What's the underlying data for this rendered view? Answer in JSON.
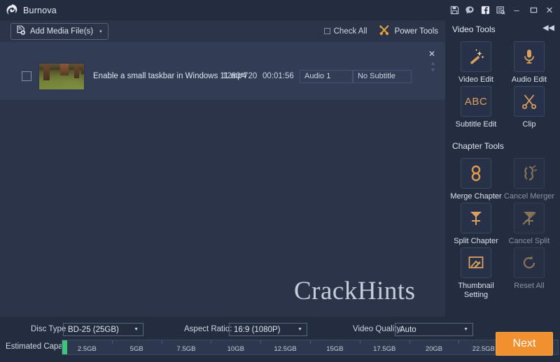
{
  "window": {
    "app_title": "Burnova",
    "logo_icon": "burnova-swirl-logo",
    "title_icons": [
      {
        "name": "save-icon",
        "glyph": "save"
      },
      {
        "name": "feedback-icon",
        "glyph": "comment"
      },
      {
        "name": "facebook-icon",
        "glyph": "facebook"
      },
      {
        "name": "register-icon",
        "glyph": "note-search"
      }
    ],
    "controls": {
      "minimize": "–",
      "maximize": "☐",
      "close": "✕"
    }
  },
  "toolbar": {
    "add_media_label": "Add Media File(s)",
    "add_media_icon": "add-file-icon",
    "add_media_caret": "▾",
    "check_all_label": "Check All",
    "power_tools_label": "Power Tools",
    "power_tools_icon": "crossed-tools-icon"
  },
  "file_list": {
    "rows": [
      {
        "checked": false,
        "thumbnail": "forest-video-thumbnail",
        "name": "Enable a small taskbar in Windows 11.mp4",
        "resolution": "1280*720",
        "duration": "00:01:56",
        "audio": "Audio 1",
        "subtitle": "No Subtitle",
        "remove": "✕"
      }
    ],
    "scroll_up": "▲",
    "scroll_down": "▼"
  },
  "watermark": "CrackHints",
  "right_panel": {
    "collapse_icon": "◀◀",
    "sections": [
      {
        "title": "Video Tools",
        "tools": [
          {
            "label": "Video Edit",
            "icon": "magic-wand-icon",
            "enabled": true
          },
          {
            "label": "Audio Edit",
            "icon": "microphone-icon",
            "enabled": true
          },
          {
            "label": "Subtitle Edit",
            "icon": "abc-icon",
            "enabled": true,
            "text": "ABC"
          },
          {
            "label": "Clip",
            "icon": "scissors-icon",
            "enabled": true
          }
        ]
      },
      {
        "title": "Chapter Tools",
        "tools": [
          {
            "label": "Merge Chapter",
            "icon": "chain-link-icon",
            "enabled": true
          },
          {
            "label": "Cancel Merger",
            "icon": "broken-chain-icon",
            "enabled": false
          },
          {
            "label": "Split Chapter",
            "icon": "split-icon",
            "enabled": true
          },
          {
            "label": "Cancel Split",
            "icon": "cancel-split-icon",
            "enabled": false
          },
          {
            "label": "Thumbnail Setting",
            "icon": "thumbnail-image-icon",
            "enabled": true
          },
          {
            "label": "Reset All",
            "icon": "reset-arrow-icon",
            "enabled": false
          }
        ]
      }
    ]
  },
  "bottom_bar": {
    "disc_type_label": "Disc Type",
    "disc_type_value": "BD-25 (25GB)",
    "aspect_ratio_label": "Aspect Ratio:",
    "aspect_ratio_value": "16:9 (1080P)",
    "video_quality_label": "Video Quality:",
    "video_quality_value": "Auto",
    "capacity_label": "Estimated Capacity:",
    "capacity_ticks": [
      "2.5GB",
      "5GB",
      "7.5GB",
      "10GB",
      "12.5GB",
      "15GB",
      "17.5GB",
      "20GB",
      "22.5GB"
    ],
    "capacity_used_percent": 1,
    "next_label": "Next",
    "accent_color": "#f0902e",
    "capacity_fill_color": "#3fc27a"
  }
}
